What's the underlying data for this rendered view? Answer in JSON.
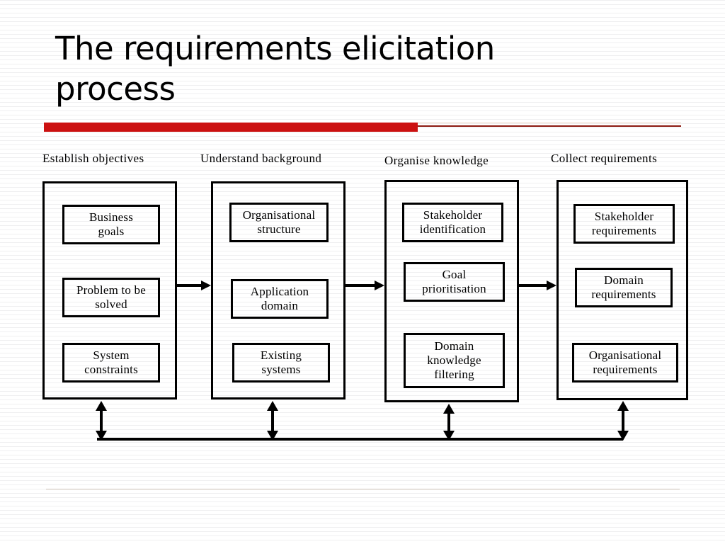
{
  "slide": {
    "title": "The requirements elicitation process",
    "accent_bar_color": "#cc1111",
    "rule_color": "#8c1a10",
    "background_color": "#ffffff",
    "line_color": "#000000"
  },
  "diagram": {
    "stages": [
      {
        "label": "Establish objectives",
        "items": [
          {
            "text": "Business\ngoals"
          },
          {
            "text": "Problem to be\nsolved"
          },
          {
            "text": "System\nconstraints"
          }
        ]
      },
      {
        "label": "Understand background",
        "items": [
          {
            "text": "Organisational\nstructure"
          },
          {
            "text": "Application\ndomain"
          },
          {
            "text": "Existing\nsystems"
          }
        ]
      },
      {
        "label": "Organise knowledge",
        "items": [
          {
            "text": "Stakeholder\nidentification"
          },
          {
            "text": "Goal\nprioritisation"
          },
          {
            "text": "Domain\nknowledge\nfiltering"
          }
        ]
      },
      {
        "label": "Collect requirements",
        "items": [
          {
            "text": "Stakeholder\nrequirements"
          },
          {
            "text": "Domain\nrequirements"
          },
          {
            "text": "Organisational\nrequirements"
          }
        ]
      }
    ],
    "flow_arrows": [
      {
        "name": "arrow-stage1-to-stage2"
      },
      {
        "name": "arrow-stage2-to-stage3"
      },
      {
        "name": "arrow-stage3-to-stage4"
      }
    ],
    "feedback_arrows": [
      {
        "name": "feedback-arrow-stage1"
      },
      {
        "name": "feedback-arrow-stage2"
      },
      {
        "name": "feedback-arrow-stage3"
      },
      {
        "name": "feedback-arrow-stage4"
      }
    ]
  }
}
